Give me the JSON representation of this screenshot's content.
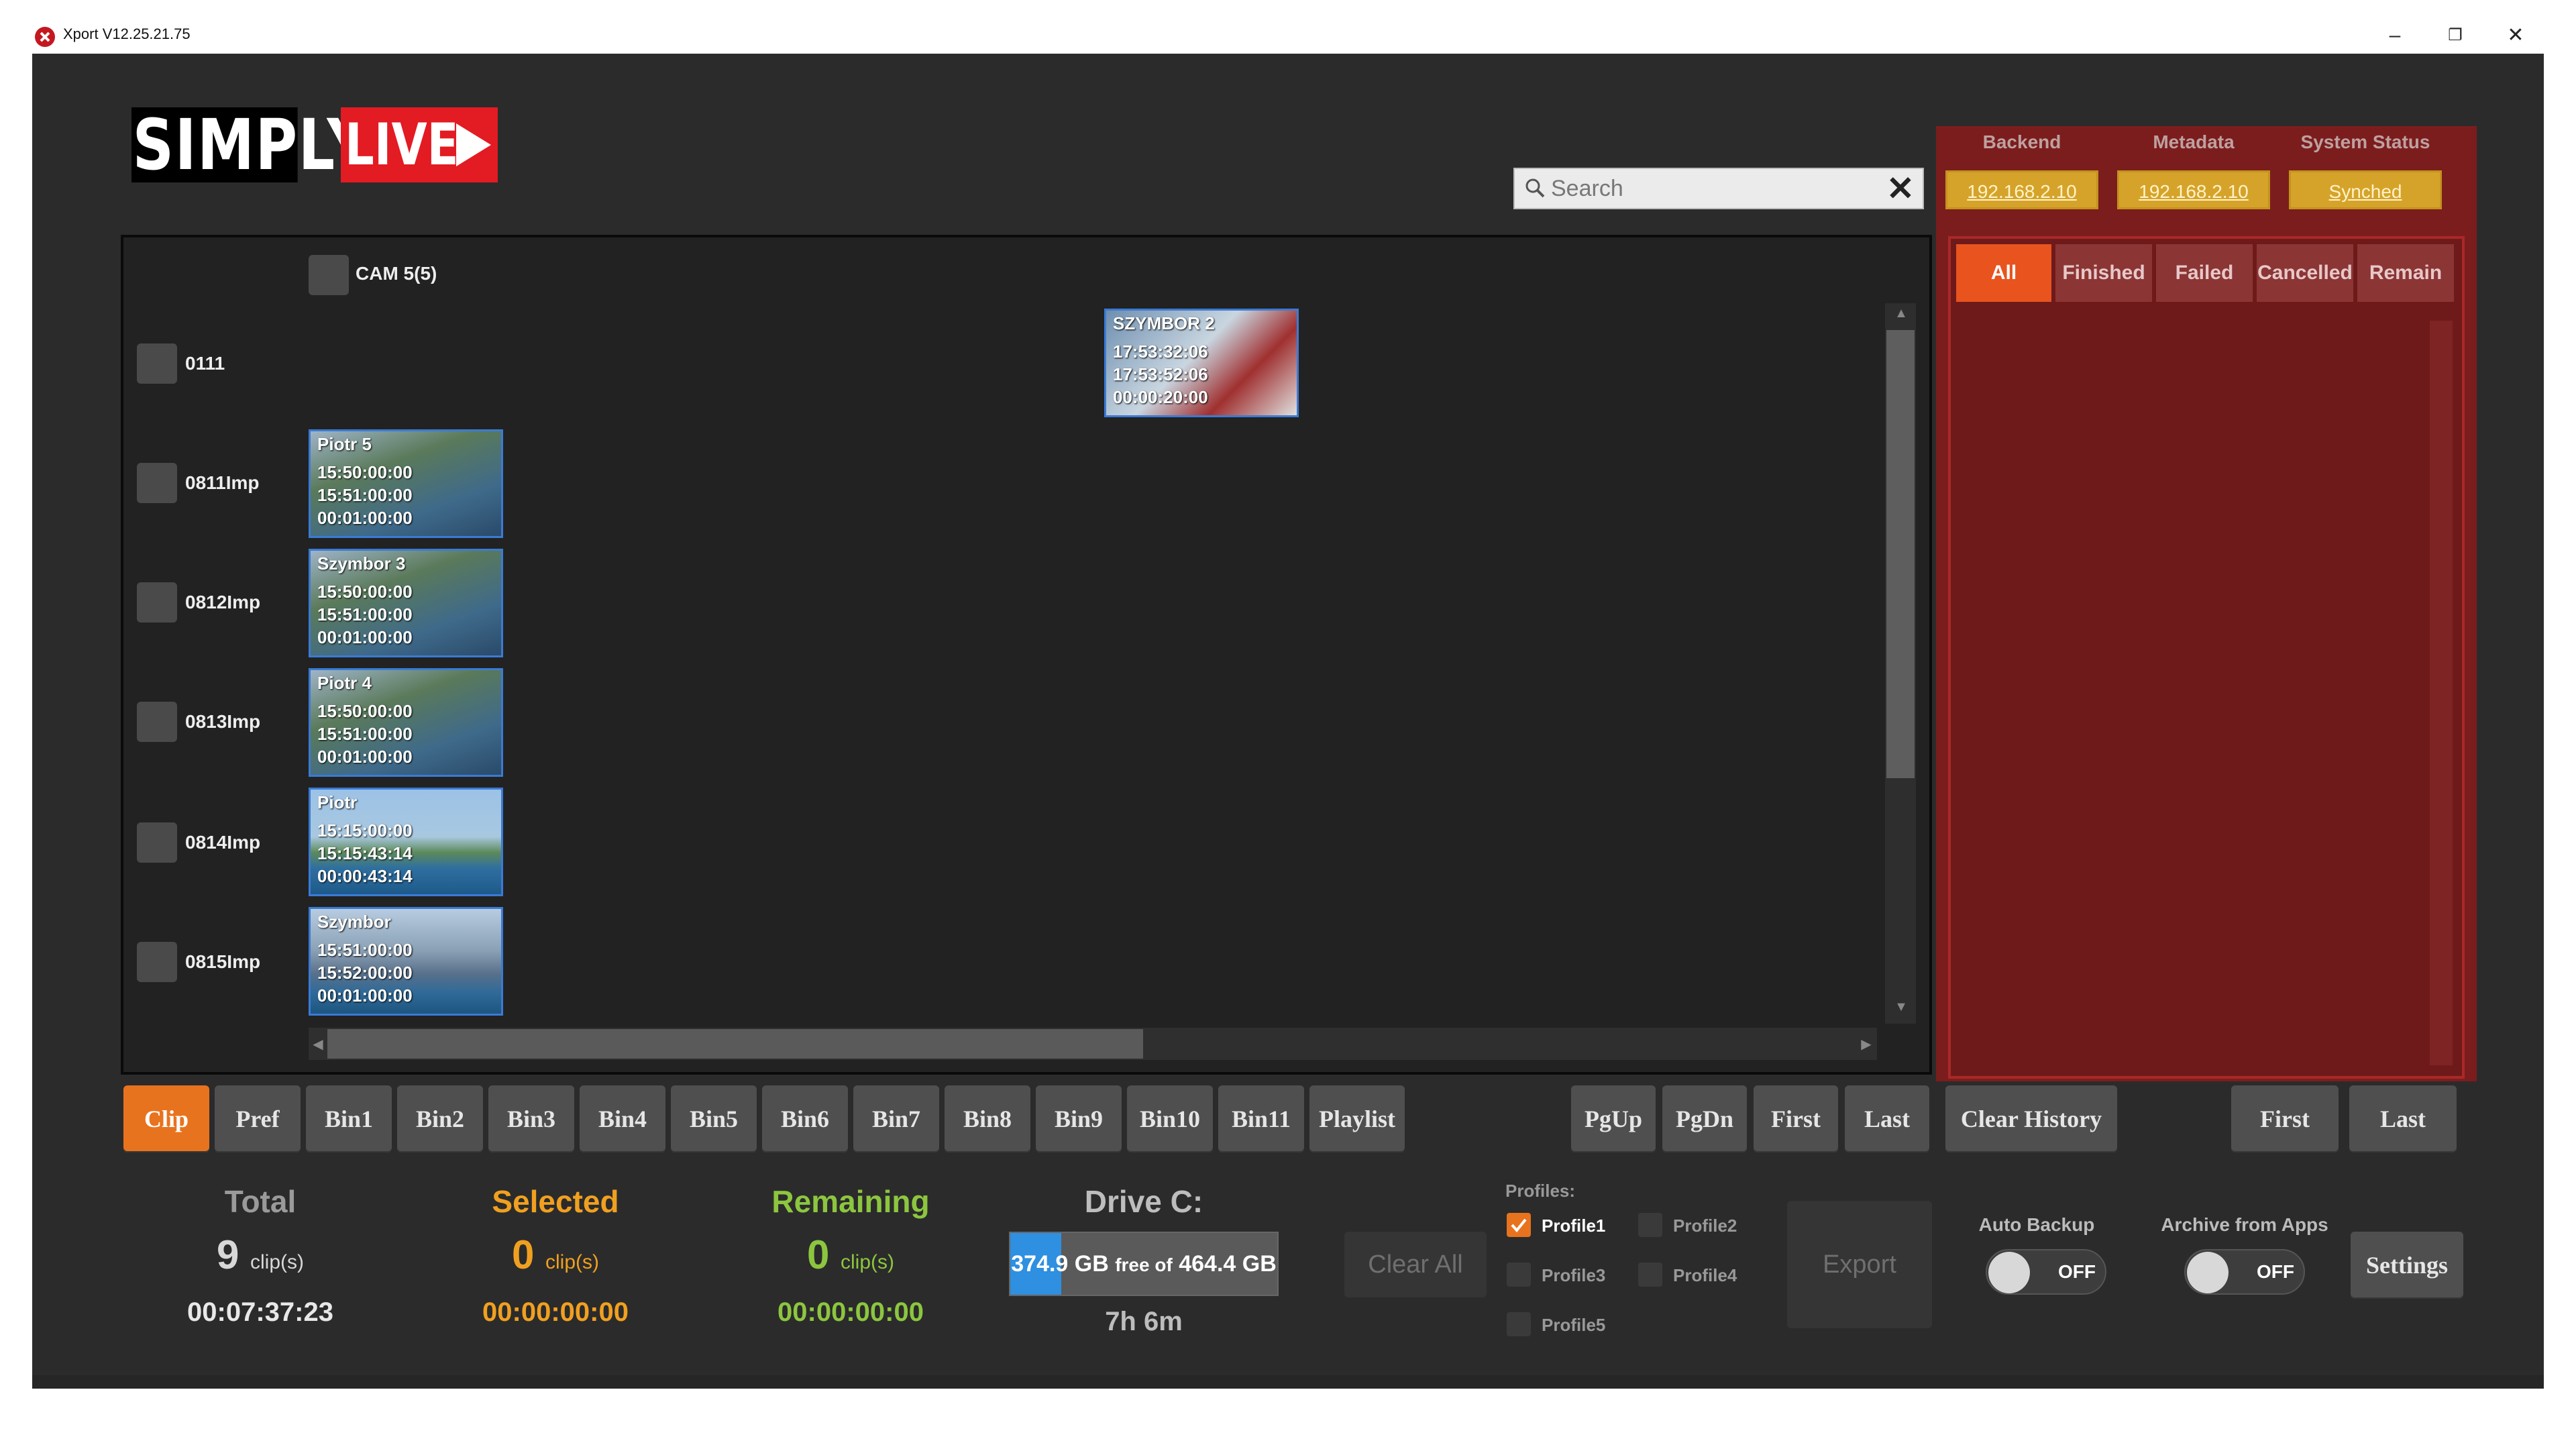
{
  "window": {
    "title": "Xport V12.25.21.75"
  },
  "logo": {
    "simply": "SIMPLY",
    "live": "LIVE"
  },
  "search": {
    "placeholder": "Search"
  },
  "camera": {
    "label": "CAM 5(5)"
  },
  "rows": [
    {
      "label": "0111"
    },
    {
      "label": "0811Imp"
    },
    {
      "label": "0812Imp"
    },
    {
      "label": "0813Imp"
    },
    {
      "label": "0814Imp"
    },
    {
      "label": "0815Imp"
    }
  ],
  "clips": [
    {
      "name": "SZYMBOR 2",
      "in": "17:53:32:06",
      "out": "17:53:52:06",
      "duration": "00:00:20:00"
    },
    {
      "name": "Piotr 5",
      "in": "15:50:00:00",
      "out": "15:51:00:00",
      "duration": "00:01:00:00"
    },
    {
      "name": "Szymbor 3",
      "in": "15:50:00:00",
      "out": "15:51:00:00",
      "duration": "00:01:00:00"
    },
    {
      "name": "Piotr 4",
      "in": "15:50:00:00",
      "out": "15:51:00:00",
      "duration": "00:01:00:00"
    },
    {
      "name": "Piotr",
      "in": "15:15:00:00",
      "out": "15:15:43:14",
      "duration": "00:00:43:14"
    },
    {
      "name": "Szymbor",
      "in": "15:51:00:00",
      "out": "15:52:00:00",
      "duration": "00:01:00:00"
    }
  ],
  "status": {
    "backend_label": "Backend",
    "backend_value": "192.168.2.10",
    "metadata_label": "Metadata",
    "metadata_value": "192.168.2.10",
    "system_label": "System Status",
    "system_value": "Synched"
  },
  "filter_tabs": [
    "All",
    "Finished",
    "Failed",
    "Cancelled",
    "Remain"
  ],
  "bin_tabs": [
    "Clip",
    "Pref",
    "Bin1",
    "Bin2",
    "Bin3",
    "Bin4",
    "Bin5",
    "Bin6",
    "Bin7",
    "Bin8",
    "Bin9",
    "Bin10",
    "Bin11",
    "Playlist"
  ],
  "nav": {
    "pgup": "PgUp",
    "pgdn": "PgDn",
    "first": "First",
    "last": "Last",
    "clear_history": "Clear History",
    "first2": "First",
    "last2": "Last"
  },
  "summary": {
    "total_label": "Total",
    "total_count": "9",
    "total_unit": "clip(s)",
    "total_time": "00:07:37:23",
    "selected_label": "Selected",
    "selected_count": "0",
    "selected_unit": "clip(s)",
    "selected_time": "00:00:00:00",
    "remaining_label": "Remaining",
    "remaining_count": "0",
    "remaining_unit": "clip(s)",
    "remaining_time": "00:00:00:00"
  },
  "drive": {
    "label": "Drive C:",
    "free": "374.9 GB",
    "free_of": "free of",
    "total": "464.4 GB",
    "time_left": "7h 6m",
    "used_fraction": 0.19
  },
  "clear_all": "Clear All",
  "profiles": {
    "title": "Profiles:",
    "items": [
      {
        "label": "Profile1",
        "checked": true
      },
      {
        "label": "Profile2",
        "checked": false
      },
      {
        "label": "Profile3",
        "checked": false
      },
      {
        "label": "Profile4",
        "checked": false
      },
      {
        "label": "Profile5",
        "checked": false
      }
    ]
  },
  "export": "Export",
  "auto_backup": {
    "label": "Auto Backup",
    "state": "OFF"
  },
  "archive": {
    "label": "Archive from Apps",
    "state": "OFF"
  },
  "settings": "Settings",
  "colors": {
    "accent": "#e8731e",
    "selected": "#f0a020",
    "remaining": "#8cc63f",
    "panel_red": "#7b1d1d",
    "badge": "#d6a32a"
  }
}
